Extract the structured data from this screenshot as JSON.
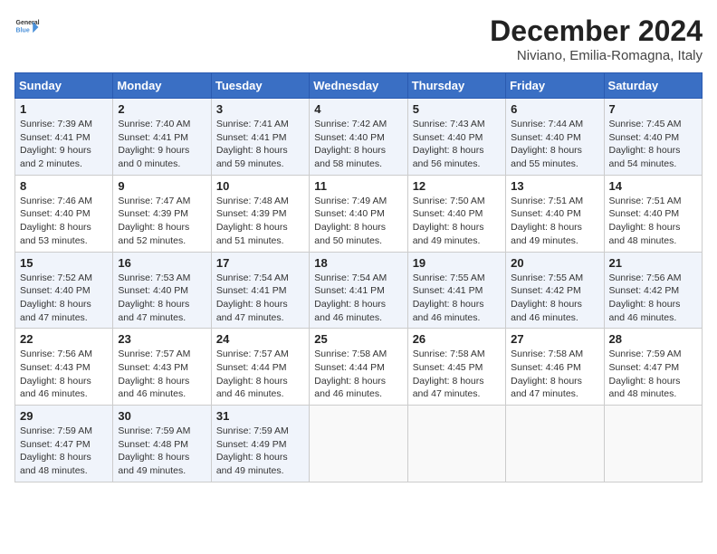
{
  "logo": {
    "line1": "General",
    "line2": "Blue"
  },
  "title": "December 2024",
  "subtitle": "Niviano, Emilia-Romagna, Italy",
  "days_of_week": [
    "Sunday",
    "Monday",
    "Tuesday",
    "Wednesday",
    "Thursday",
    "Friday",
    "Saturday"
  ],
  "weeks": [
    [
      {
        "day": "1",
        "text": "Sunrise: 7:39 AM\nSunset: 4:41 PM\nDaylight: 9 hours\nand 2 minutes."
      },
      {
        "day": "2",
        "text": "Sunrise: 7:40 AM\nSunset: 4:41 PM\nDaylight: 9 hours\nand 0 minutes."
      },
      {
        "day": "3",
        "text": "Sunrise: 7:41 AM\nSunset: 4:41 PM\nDaylight: 8 hours\nand 59 minutes."
      },
      {
        "day": "4",
        "text": "Sunrise: 7:42 AM\nSunset: 4:40 PM\nDaylight: 8 hours\nand 58 minutes."
      },
      {
        "day": "5",
        "text": "Sunrise: 7:43 AM\nSunset: 4:40 PM\nDaylight: 8 hours\nand 56 minutes."
      },
      {
        "day": "6",
        "text": "Sunrise: 7:44 AM\nSunset: 4:40 PM\nDaylight: 8 hours\nand 55 minutes."
      },
      {
        "day": "7",
        "text": "Sunrise: 7:45 AM\nSunset: 4:40 PM\nDaylight: 8 hours\nand 54 minutes."
      }
    ],
    [
      {
        "day": "8",
        "text": "Sunrise: 7:46 AM\nSunset: 4:40 PM\nDaylight: 8 hours\nand 53 minutes."
      },
      {
        "day": "9",
        "text": "Sunrise: 7:47 AM\nSunset: 4:39 PM\nDaylight: 8 hours\nand 52 minutes."
      },
      {
        "day": "10",
        "text": "Sunrise: 7:48 AM\nSunset: 4:39 PM\nDaylight: 8 hours\nand 51 minutes."
      },
      {
        "day": "11",
        "text": "Sunrise: 7:49 AM\nSunset: 4:40 PM\nDaylight: 8 hours\nand 50 minutes."
      },
      {
        "day": "12",
        "text": "Sunrise: 7:50 AM\nSunset: 4:40 PM\nDaylight: 8 hours\nand 49 minutes."
      },
      {
        "day": "13",
        "text": "Sunrise: 7:51 AM\nSunset: 4:40 PM\nDaylight: 8 hours\nand 49 minutes."
      },
      {
        "day": "14",
        "text": "Sunrise: 7:51 AM\nSunset: 4:40 PM\nDaylight: 8 hours\nand 48 minutes."
      }
    ],
    [
      {
        "day": "15",
        "text": "Sunrise: 7:52 AM\nSunset: 4:40 PM\nDaylight: 8 hours\nand 47 minutes."
      },
      {
        "day": "16",
        "text": "Sunrise: 7:53 AM\nSunset: 4:40 PM\nDaylight: 8 hours\nand 47 minutes."
      },
      {
        "day": "17",
        "text": "Sunrise: 7:54 AM\nSunset: 4:41 PM\nDaylight: 8 hours\nand 47 minutes."
      },
      {
        "day": "18",
        "text": "Sunrise: 7:54 AM\nSunset: 4:41 PM\nDaylight: 8 hours\nand 46 minutes."
      },
      {
        "day": "19",
        "text": "Sunrise: 7:55 AM\nSunset: 4:41 PM\nDaylight: 8 hours\nand 46 minutes."
      },
      {
        "day": "20",
        "text": "Sunrise: 7:55 AM\nSunset: 4:42 PM\nDaylight: 8 hours\nand 46 minutes."
      },
      {
        "day": "21",
        "text": "Sunrise: 7:56 AM\nSunset: 4:42 PM\nDaylight: 8 hours\nand 46 minutes."
      }
    ],
    [
      {
        "day": "22",
        "text": "Sunrise: 7:56 AM\nSunset: 4:43 PM\nDaylight: 8 hours\nand 46 minutes."
      },
      {
        "day": "23",
        "text": "Sunrise: 7:57 AM\nSunset: 4:43 PM\nDaylight: 8 hours\nand 46 minutes."
      },
      {
        "day": "24",
        "text": "Sunrise: 7:57 AM\nSunset: 4:44 PM\nDaylight: 8 hours\nand 46 minutes."
      },
      {
        "day": "25",
        "text": "Sunrise: 7:58 AM\nSunset: 4:44 PM\nDaylight: 8 hours\nand 46 minutes."
      },
      {
        "day": "26",
        "text": "Sunrise: 7:58 AM\nSunset: 4:45 PM\nDaylight: 8 hours\nand 47 minutes."
      },
      {
        "day": "27",
        "text": "Sunrise: 7:58 AM\nSunset: 4:46 PM\nDaylight: 8 hours\nand 47 minutes."
      },
      {
        "day": "28",
        "text": "Sunrise: 7:59 AM\nSunset: 4:47 PM\nDaylight: 8 hours\nand 48 minutes."
      }
    ],
    [
      {
        "day": "29",
        "text": "Sunrise: 7:59 AM\nSunset: 4:47 PM\nDaylight: 8 hours\nand 48 minutes."
      },
      {
        "day": "30",
        "text": "Sunrise: 7:59 AM\nSunset: 4:48 PM\nDaylight: 8 hours\nand 49 minutes."
      },
      {
        "day": "31",
        "text": "Sunrise: 7:59 AM\nSunset: 4:49 PM\nDaylight: 8 hours\nand 49 minutes."
      },
      {
        "day": "",
        "text": ""
      },
      {
        "day": "",
        "text": ""
      },
      {
        "day": "",
        "text": ""
      },
      {
        "day": "",
        "text": ""
      }
    ]
  ]
}
